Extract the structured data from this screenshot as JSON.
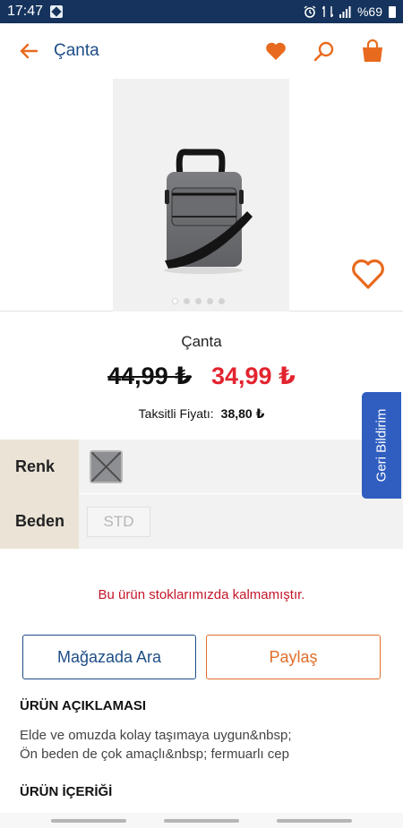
{
  "status_bar": {
    "time": "17:47",
    "battery": "%69",
    "icons": [
      "app-notification-icon",
      "alarm-icon",
      "network-icon",
      "signal-icon",
      "battery-icon"
    ]
  },
  "app_bar": {
    "title": "Çanta",
    "icons": [
      "back-arrow-icon",
      "heart-icon",
      "search-icon",
      "shopping-bag-icon"
    ]
  },
  "gallery": {
    "image_count": 5,
    "active_index": 0
  },
  "product": {
    "name": "Çanta",
    "old_price": "44,99 ₺",
    "new_price": "34,99 ₺",
    "installment_label": "Taksitli Fiyatı:",
    "installment_price": "38,80 ₺"
  },
  "variants": {
    "color_label": "Renk",
    "size_label": "Beden",
    "size_value": "STD"
  },
  "feedback_tab": "Geri Bildirim",
  "stock_message": "Bu ürün stoklarımızda kalmamıştır.",
  "buttons": {
    "store": "Mağazada Ara",
    "share": "Paylaş"
  },
  "description": {
    "title": "ÜRÜN AÇIKLAMASI",
    "lines": [
      "Elde ve omuzda kolay taşımaya uygun&nbsp;",
      "Ön beden de çok amaçlı&nbsp; fermuarlı cep"
    ]
  },
  "contents": {
    "title": "ÜRÜN İÇERİĞİ"
  },
  "colors": {
    "accent_orange": "#e86a1e",
    "primary_blue": "#1d4d86",
    "sale_red": "#e2242f",
    "status_bar": "#15335c",
    "feedback_blue": "#2f5dc0"
  }
}
